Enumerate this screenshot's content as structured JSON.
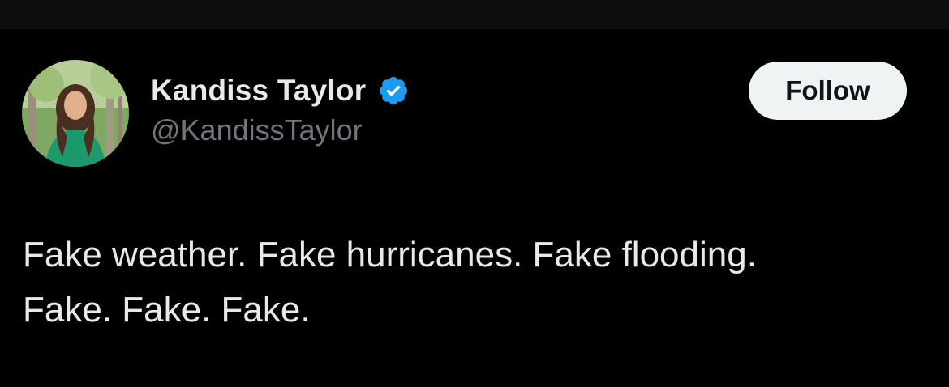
{
  "author": {
    "display_name": "Kandiss Taylor",
    "handle": "@KandissTaylor",
    "verified": true,
    "avatar_icon": "profile-photo"
  },
  "actions": {
    "follow_label": "Follow"
  },
  "tweet": {
    "lines": [
      "Fake weather. Fake hurricanes. Fake flooding.",
      "Fake. Fake. Fake."
    ]
  },
  "colors": {
    "background": "#000000",
    "text_primary": "#e7e9ea",
    "text_secondary": "#71767b",
    "verified_badge": "#1d9bf0",
    "follow_button_bg": "#eff3f4"
  }
}
